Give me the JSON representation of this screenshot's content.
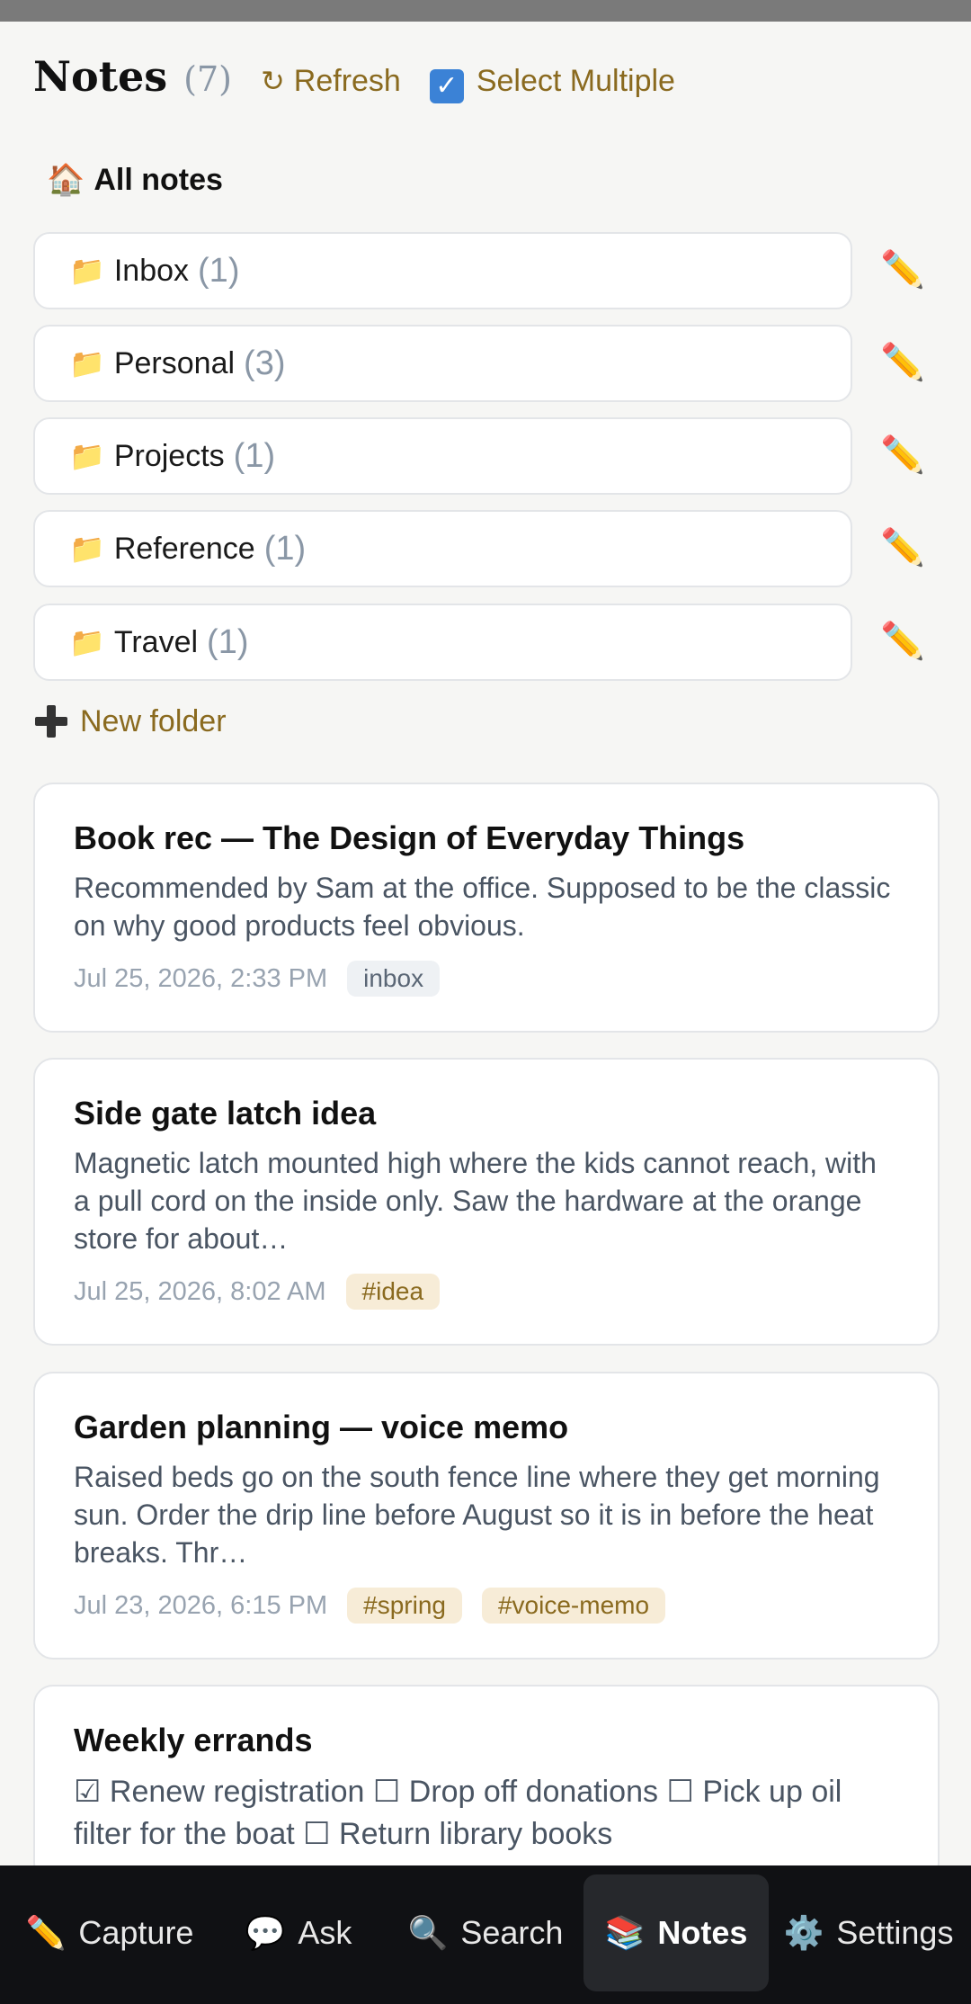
{
  "header": {
    "title": "Notes",
    "count": "(7)",
    "refresh_icon": "↻",
    "refresh_label": "Refresh",
    "select_icon": "✓",
    "select_label": "Select Multiple"
  },
  "all_notes": {
    "icon": "🏠",
    "label": "All notes"
  },
  "folders": [
    {
      "icon": "📁",
      "name": "Inbox",
      "count": "(1)",
      "edit_icon": "✏️"
    },
    {
      "icon": "📁",
      "name": "Personal",
      "count": "(3)",
      "edit_icon": "✏️"
    },
    {
      "icon": "📁",
      "name": "Projects",
      "count": "(1)",
      "edit_icon": "✏️"
    },
    {
      "icon": "📁",
      "name": "Reference",
      "count": "(1)",
      "edit_icon": "✏️"
    },
    {
      "icon": "📁",
      "name": "Travel",
      "count": "(1)",
      "edit_icon": "✏️"
    }
  ],
  "new_folder_label": "New folder",
  "notes": [
    {
      "title": "Book rec — The Design of Everyday Things",
      "body": "Recommended by Sam at the office. Supposed to be the classic on why good products feel obvious.",
      "date": "Jul 25, 2026, 2:33 PM",
      "tags": [
        "inbox"
      ]
    },
    {
      "title": "Side gate latch idea",
      "body": "Magnetic latch mounted high where the kids cannot reach, with a pull cord on the inside only. Saw the hardware at the orange store for about…",
      "date": "Jul 25, 2026, 8:02 AM",
      "tags": [
        "#idea"
      ]
    },
    {
      "title": "Garden planning — voice memo",
      "body": "Raised beds go on the south fence line where they get morning sun. Order the drip line before August so it is in before the heat breaks. Thr…",
      "date": "Jul 23, 2026, 6:15 PM",
      "tags": [
        "#spring",
        "#voice-memo"
      ]
    },
    {
      "title": "Weekly errands",
      "body": "☑ Renew registration ☐ Drop off donations ☐ Pick up oil filter for the boat ☐ Return library books"
    }
  ],
  "tabs": [
    {
      "icon": "✏️",
      "label": "Capture"
    },
    {
      "icon": "💬",
      "label": "Ask"
    },
    {
      "icon": "🔍",
      "label": "Search"
    },
    {
      "icon": "📚",
      "label": "Notes"
    },
    {
      "icon": "⚙️",
      "label": "Settings"
    }
  ],
  "active_tab": "Notes",
  "colors": {
    "accent": "#8a6a1f",
    "tabbar": "#101114",
    "muted": "#8a97a6"
  }
}
